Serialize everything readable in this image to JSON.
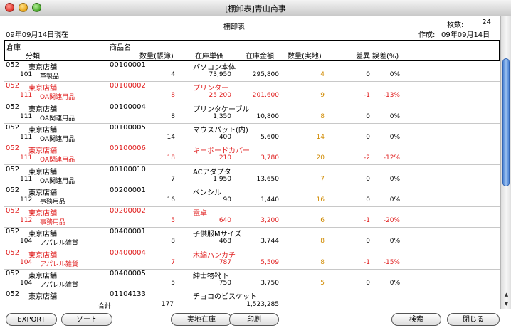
{
  "window": {
    "title": "[棚卸表]青山商事"
  },
  "header": {
    "date_label": "09年09月14日現在",
    "report_title": "棚卸表",
    "pages_label": "枚数:",
    "pages_value": "24",
    "created_label": "作成:",
    "created_value": "09年09月14日"
  },
  "columns": {
    "warehouse": "倉庫",
    "category": "分類",
    "product": "商品名",
    "qty_book": "数量(帳簿)",
    "unit_price": "在庫単価",
    "amount": "在庫金額",
    "qty_actual": "数量(実地)",
    "diff": "差異",
    "error_pct": "誤差(%)"
  },
  "rows": [
    {
      "wh_code": "052",
      "wh_name": "東京店舗",
      "cat_code": "101",
      "cat_name": "革製品",
      "code": "00100001",
      "name": "パソコン本体",
      "qty_book": "4",
      "unit_price": "73,950",
      "amount": "295,800",
      "qty_actual": "4",
      "diff": "0",
      "error": "0%",
      "highlight": false
    },
    {
      "wh_code": "052",
      "wh_name": "東京店舗",
      "cat_code": "111",
      "cat_name": "OA関連用品",
      "code": "00100002",
      "name": "プリンター",
      "qty_book": "8",
      "unit_price": "25,200",
      "amount": "201,600",
      "qty_actual": "9",
      "diff": "-1",
      "error": "-13%",
      "highlight": true
    },
    {
      "wh_code": "052",
      "wh_name": "東京店舗",
      "cat_code": "111",
      "cat_name": "OA関連用品",
      "code": "00100004",
      "name": "プリンタケーブル",
      "qty_book": "8",
      "unit_price": "1,350",
      "amount": "10,800",
      "qty_actual": "8",
      "diff": "0",
      "error": "0%",
      "highlight": false
    },
    {
      "wh_code": "052",
      "wh_name": "東京店舗",
      "cat_code": "111",
      "cat_name": "OA関連用品",
      "code": "00100005",
      "name": "マウスパット(内)",
      "qty_book": "14",
      "unit_price": "400",
      "amount": "5,600",
      "qty_actual": "14",
      "diff": "0",
      "error": "0%",
      "highlight": false
    },
    {
      "wh_code": "052",
      "wh_name": "東京店舗",
      "cat_code": "111",
      "cat_name": "OA関連用品",
      "code": "00100006",
      "name": "キーボードカバー",
      "qty_book": "18",
      "unit_price": "210",
      "amount": "3,780",
      "qty_actual": "20",
      "diff": "-2",
      "error": "-12%",
      "highlight": true
    },
    {
      "wh_code": "052",
      "wh_name": "東京店舗",
      "cat_code": "111",
      "cat_name": "OA関連用品",
      "code": "00100010",
      "name": "ACアダプタ",
      "qty_book": "7",
      "unit_price": "1,950",
      "amount": "13,650",
      "qty_actual": "7",
      "diff": "0",
      "error": "0%",
      "highlight": false
    },
    {
      "wh_code": "052",
      "wh_name": "東京店舗",
      "cat_code": "112",
      "cat_name": "事務用品",
      "code": "00200001",
      "name": "ペンシル",
      "qty_book": "16",
      "unit_price": "90",
      "amount": "1,440",
      "qty_actual": "16",
      "diff": "0",
      "error": "0%",
      "highlight": false
    },
    {
      "wh_code": "052",
      "wh_name": "東京店舗",
      "cat_code": "112",
      "cat_name": "事務用品",
      "code": "00200002",
      "name": "電卓",
      "qty_book": "5",
      "unit_price": "640",
      "amount": "3,200",
      "qty_actual": "6",
      "diff": "-1",
      "error": "-20%",
      "highlight": true
    },
    {
      "wh_code": "052",
      "wh_name": "東京店舗",
      "cat_code": "104",
      "cat_name": "アパレル雑貨",
      "code": "00400001",
      "name": "子供服Mサイズ",
      "qty_book": "8",
      "unit_price": "468",
      "amount": "3,744",
      "qty_actual": "8",
      "diff": "0",
      "error": "0%",
      "highlight": false
    },
    {
      "wh_code": "052",
      "wh_name": "東京店舗",
      "cat_code": "104",
      "cat_name": "アパレル雑貨",
      "code": "00400004",
      "name": "木綿ハンカチ",
      "qty_book": "7",
      "unit_price": "787",
      "amount": "5,509",
      "qty_actual": "8",
      "diff": "-1",
      "error": "-15%",
      "highlight": true
    },
    {
      "wh_code": "052",
      "wh_name": "東京店舗",
      "cat_code": "104",
      "cat_name": "アパレル雑貨",
      "code": "00400005",
      "name": "紳士物靴下",
      "qty_book": "5",
      "unit_price": "750",
      "amount": "3,750",
      "qty_actual": "5",
      "diff": "0",
      "error": "0%",
      "highlight": false
    },
    {
      "wh_code": "052",
      "wh_name": "東京店舗",
      "cat_code": "",
      "cat_name": "",
      "code": "01104133",
      "name": "チョコのビスケット",
      "qty_book": "",
      "unit_price": "",
      "amount": "",
      "qty_actual": "",
      "diff": "",
      "error": "",
      "highlight": false
    }
  ],
  "totals": {
    "label": "合計",
    "qty": "177",
    "amount": "1,523,285"
  },
  "buttons": {
    "export": "EXPORT",
    "sort": "ソート",
    "actual_stock": "実地在庫",
    "print": "印刷",
    "search": "検索",
    "close": "閉じる"
  },
  "colors": {
    "highlight": "#e02020",
    "actual": "#d08a00"
  }
}
